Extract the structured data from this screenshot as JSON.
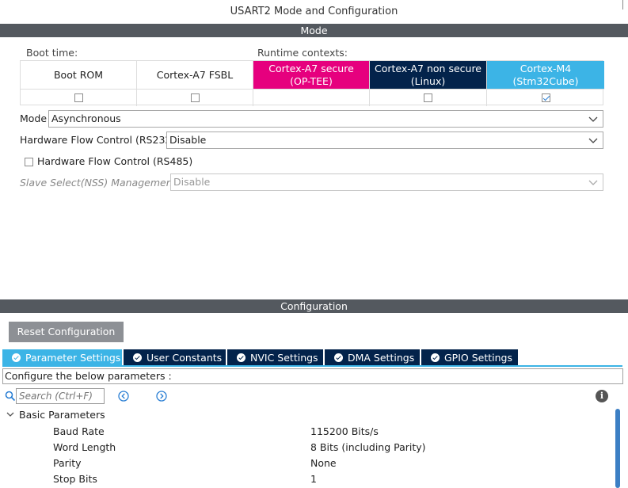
{
  "window": {
    "title": "USART2 Mode and Configuration"
  },
  "mode_section": {
    "header": "Mode",
    "boot_time_label": "Boot time:",
    "runtime_label": "Runtime contexts:",
    "contexts": [
      {
        "label_line1": "Boot ROM",
        "label_line2": "",
        "checkbox": "unchecked",
        "bg": "#ffffff",
        "fg": "#222222"
      },
      {
        "label_line1": "Cortex-A7 FSBL",
        "label_line2": "",
        "checkbox": "unchecked",
        "bg": "#ffffff",
        "fg": "#222222"
      },
      {
        "label_line1": "Cortex-A7 secure",
        "label_line2": "(OP-TEE)",
        "checkbox": "none",
        "bg": "#e6007e",
        "fg": "#ffffff"
      },
      {
        "label_line1": "Cortex-A7 non secure",
        "label_line2": "(Linux)",
        "checkbox": "unchecked",
        "bg": "#03234b",
        "fg": "#ffffff"
      },
      {
        "label_line1": "Cortex-M4",
        "label_line2": "(Stm32Cube)",
        "checkbox": "checked",
        "bg": "#3cb4e6",
        "fg": "#ffffff"
      }
    ],
    "mode": {
      "label": "Mode",
      "value": "Asynchronous"
    },
    "hw_flow_rs232": {
      "label": "Hardware Flow Control (RS232)",
      "value": "Disable"
    },
    "hw_flow_rs485": {
      "label": "Hardware Flow Control (RS485)",
      "checked": false
    },
    "slave_select": {
      "label": "Slave Select(NSS) Management",
      "value": "Disable"
    }
  },
  "config_section": {
    "header": "Configuration",
    "reset_button": "Reset Configuration",
    "tabs": [
      {
        "label": "Parameter Settings",
        "active": true
      },
      {
        "label": "User Constants",
        "active": false
      },
      {
        "label": "NVIC Settings",
        "active": false
      },
      {
        "label": "DMA Settings",
        "active": false
      },
      {
        "label": "GPIO Settings",
        "active": false
      }
    ],
    "configure_text": "Configure the below parameters :",
    "search_placeholder": "Search (Ctrl+F)",
    "group": "Basic Parameters",
    "params": [
      {
        "name": "Baud Rate",
        "value": "115200 Bits/s"
      },
      {
        "name": "Word Length",
        "value": "8 Bits (including Parity)"
      },
      {
        "name": "Parity",
        "value": "None"
      },
      {
        "name": "Stop Bits",
        "value": "1"
      }
    ]
  },
  "colors": {
    "section_bar": "#54595f",
    "accent_blue": "#3cb4e6",
    "dark_navy": "#03234b",
    "magenta": "#e6007e"
  }
}
